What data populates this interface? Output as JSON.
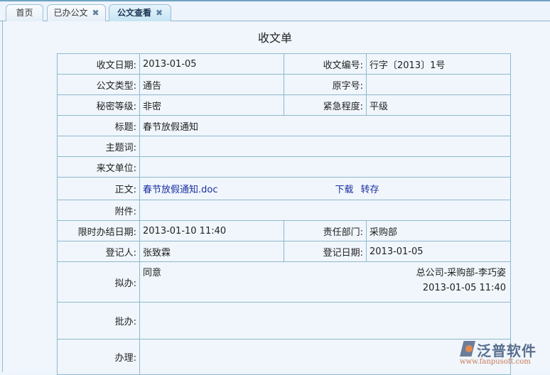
{
  "tabs": [
    {
      "label": "首页"
    },
    {
      "label": "已办公文",
      "close": "✖"
    },
    {
      "label": "公文查看",
      "close": "✖"
    }
  ],
  "form_title": "收文单",
  "fields": {
    "receive_date": {
      "label": "收文日期:",
      "value": "2013-01-05"
    },
    "receive_no": {
      "label": "收文编号:",
      "value": "行字〔2013〕1号"
    },
    "doc_type": {
      "label": "公文类型:",
      "value": "通告"
    },
    "orig_no": {
      "label": "原字号:",
      "value": ""
    },
    "secret": {
      "label": "秘密等级:",
      "value": "非密"
    },
    "urgency": {
      "label": "紧急程度:",
      "value": "平级"
    },
    "subject": {
      "label": "标题:",
      "value": "春节放假通知"
    },
    "keywords": {
      "label": "主题词:",
      "value": ""
    },
    "from_unit": {
      "label": "来文单位:",
      "value": ""
    },
    "body": {
      "label": "正文:",
      "value": "春节放假通知.doc",
      "download": "下载",
      "save": "转存"
    },
    "attach": {
      "label": "附件:",
      "value": ""
    },
    "deadline": {
      "label": "限时办结日期:",
      "value": "2013-01-10 11:40"
    },
    "dept": {
      "label": "责任部门:",
      "value": "采购部"
    },
    "registrant": {
      "label": "登记人:",
      "value": "张致霖"
    },
    "reg_date": {
      "label": "登记日期:",
      "value": "2013-01-05"
    },
    "proposal": {
      "label": "拟办:",
      "value": "同意",
      "signer": "总公司-采购部-李巧姿",
      "time": "2013-01-05 11:40"
    },
    "approve": {
      "label": "批办:",
      "value": ""
    },
    "handle": {
      "label": "办理:",
      "value": ""
    }
  },
  "logo": {
    "name": "泛普软件",
    "url": "www.fanpusoft.com"
  }
}
